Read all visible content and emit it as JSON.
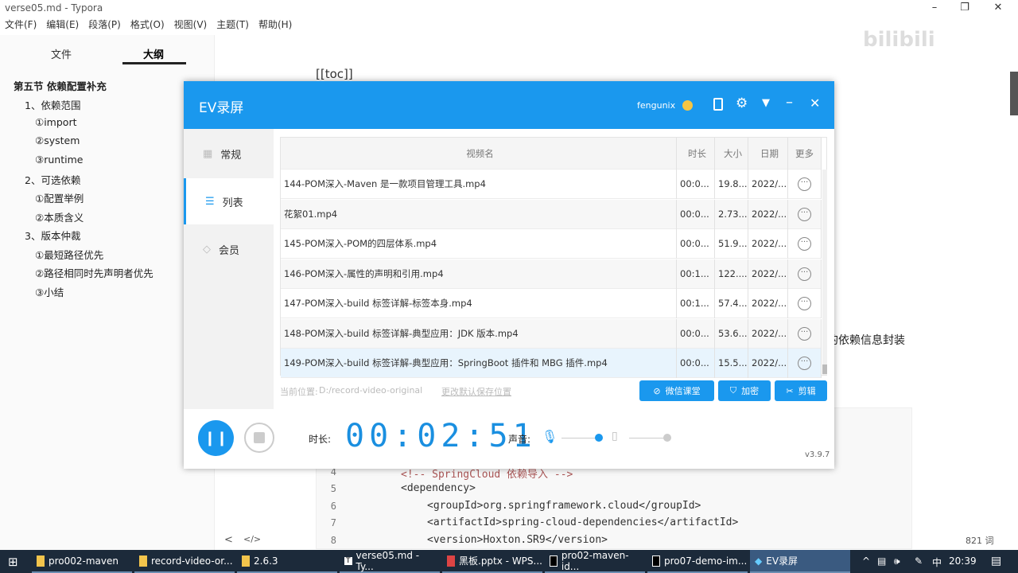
{
  "typora": {
    "title": "verse05.md - Typora",
    "menu": [
      "文件(F)",
      "编辑(E)",
      "段落(P)",
      "格式(O)",
      "视图(V)",
      "主题(T)",
      "帮助(H)"
    ],
    "sidebar_tabs": [
      "文件",
      "大纲"
    ],
    "outline": [
      "第五节 依赖配置补充",
      "1、依赖范围",
      "①import",
      "②system",
      "③runtime",
      "2、可选依赖",
      "①配置举例",
      "②本质含义",
      "3、版本仲裁",
      "①最短路径优先",
      "②路径相同时先声明者优先",
      "③小结"
    ],
    "toc": "[[toc]]",
    "partial_text": "的依赖信息封装",
    "code": [
      {
        "n": "4",
        "t": "<!-- SpringCloud 依赖导入 -->"
      },
      {
        "n": "5",
        "t": "<dependency>"
      },
      {
        "n": "6",
        "t": "<groupId>org.springframework.cloud</groupId>"
      },
      {
        "n": "7",
        "t": "<artifactId>spring-cloud-dependencies</artifactId>"
      },
      {
        "n": "8",
        "t": "<version>Hoxton.SR9</version>"
      }
    ],
    "word_count": "821 词",
    "bottom_left": "<",
    "bottom_code": "</>",
    "watermark": "bilibili"
  },
  "ev": {
    "title": "EV录屏",
    "user": "fengunix",
    "nav": [
      "常规",
      "列表",
      "会员"
    ],
    "columns": [
      "视频名",
      "时长",
      "大小",
      "日期",
      "更多"
    ],
    "rows": [
      {
        "name": "144-POM深入-Maven 是一款项目管理工具.mp4",
        "dur": "00:0...",
        "size": "19.8...",
        "date": "2022/..."
      },
      {
        "name": "花絮01.mp4",
        "dur": "00:0...",
        "size": "2.73...",
        "date": "2022/..."
      },
      {
        "name": "145-POM深入-POM的四层体系.mp4",
        "dur": "00:0...",
        "size": "51.9...",
        "date": "2022/..."
      },
      {
        "name": "146-POM深入-属性的声明和引用.mp4",
        "dur": "00:1...",
        "size": "122....",
        "date": "2022/..."
      },
      {
        "name": "147-POM深入-build 标签详解-标签本身.mp4",
        "dur": "00:1...",
        "size": "57.4...",
        "date": "2022/..."
      },
      {
        "name": "148-POM深入-build 标签详解-典型应用：JDK 版本.mp4",
        "dur": "00:0...",
        "size": "53.6...",
        "date": "2022/..."
      },
      {
        "name": "149-POM深入-build 标签详解-典型应用：SpringBoot 插件和 MBG 插件.mp4",
        "dur": "00:0...",
        "size": "15.5...",
        "date": "2022/..."
      }
    ],
    "path_label": "当前位置:",
    "path": "D:/record-video-original",
    "change_path": "更改默认保存位置",
    "buttons": [
      "微信课堂",
      "加密",
      "剪辑"
    ],
    "duration_label": "时长:",
    "timer": "00:02:51",
    "sound_label": "声音:",
    "version": "v3.9.7",
    "accent": "#1a98ee"
  },
  "taskbar": {
    "items": [
      "pro002-maven",
      "record-video-or...",
      "2.6.3",
      "verse05.md - Ty...",
      "黑板.pptx - WPS...",
      "pro02-maven-id...",
      "pro07-demo-im...",
      "EV录屏"
    ],
    "ime": "中",
    "clock": "20:39"
  }
}
